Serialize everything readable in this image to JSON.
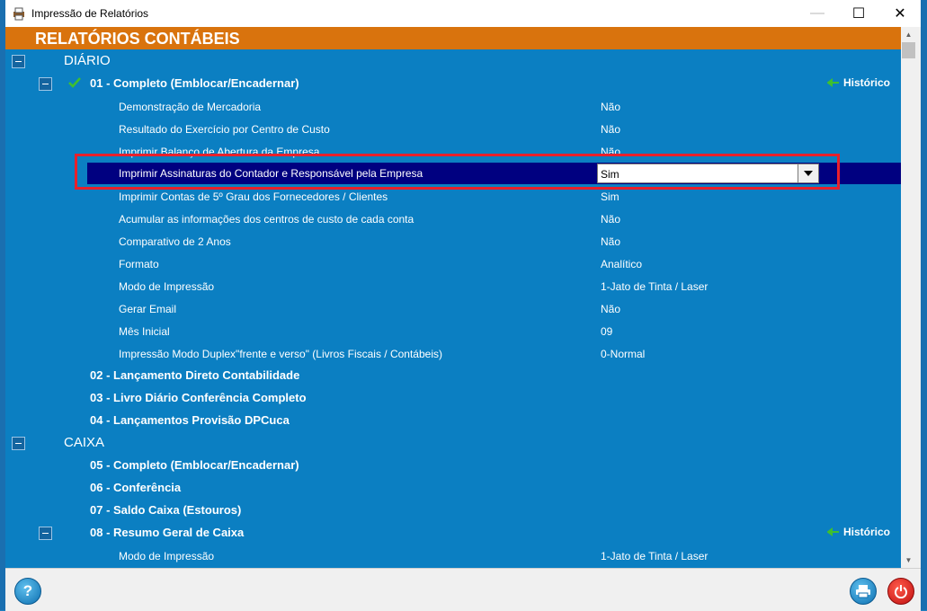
{
  "window": {
    "title": "Impressão de Relatórios",
    "minimize_glyph": "—",
    "maximize_glyph": "☐",
    "close_glyph": "✕"
  },
  "header": {
    "title": "RELATÓRIOS CONTÁBEIS"
  },
  "sections": [
    {
      "label": "DIÁRIO"
    },
    {
      "label": "CAIXA"
    }
  ],
  "items": [
    {
      "label": "01 - Completo (Emblocar/Encadernar)"
    },
    {
      "label": "02 - Lançamento Direto Contabilidade"
    },
    {
      "label": "03 - Livro Diário Conferência Completo"
    },
    {
      "label": "04 - Lançamentos Provisão DPCuca"
    },
    {
      "label": "05 - Completo (Emblocar/Encadernar)"
    },
    {
      "label": "06 - Conferência"
    },
    {
      "label": "07 - Saldo Caixa (Estouros)"
    },
    {
      "label": "08 - Resumo Geral de Caixa"
    }
  ],
  "historico_label": "Histórico",
  "params": [
    {
      "label": "Demonstração de Mercadoria",
      "value": "Não"
    },
    {
      "label": "Resultado do Exercício por Centro de Custo",
      "value": "Não"
    },
    {
      "label": "Imprimir Balanço de Abertura da Empresa",
      "value": "Não"
    },
    {
      "label": "Imprimir Assinaturas do Contador e Responsável pela Empresa",
      "value": "Sim"
    },
    {
      "label": "Imprimir Contas de 5º Grau dos Fornecedores / Clientes",
      "value": "Sim"
    },
    {
      "label": "Acumular as informações dos centros de custo de cada conta",
      "value": "Não"
    },
    {
      "label": "Comparativo de 2 Anos",
      "value": "Não"
    },
    {
      "label": "Formato",
      "value": "Analítico"
    },
    {
      "label": "Modo de Impressão",
      "value": "1-Jato de Tinta / Laser"
    },
    {
      "label": "Gerar Email",
      "value": "Não"
    },
    {
      "label": "Mês Inicial",
      "value": "09"
    },
    {
      "label": "Impressão Modo Duplex\"frente e verso\" (Livros Fiscais / Contábeis)",
      "value": "0-Normal"
    },
    {
      "label": "Modo de Impressão",
      "value": "1-Jato de Tinta / Laser"
    }
  ],
  "bottom": {
    "help_glyph": "?"
  },
  "icons": {
    "app": "printer-app-icon",
    "check": "checkmark-icon",
    "historico": "history-arrow-icon",
    "help": "help-icon",
    "print": "printer-icon",
    "power": "power-icon"
  },
  "colors": {
    "panel": "#0b7fc2",
    "header": "#d9730d",
    "selected_row": "#000080",
    "highlight_border": "#e8202b",
    "check": "#3fbf2f"
  }
}
